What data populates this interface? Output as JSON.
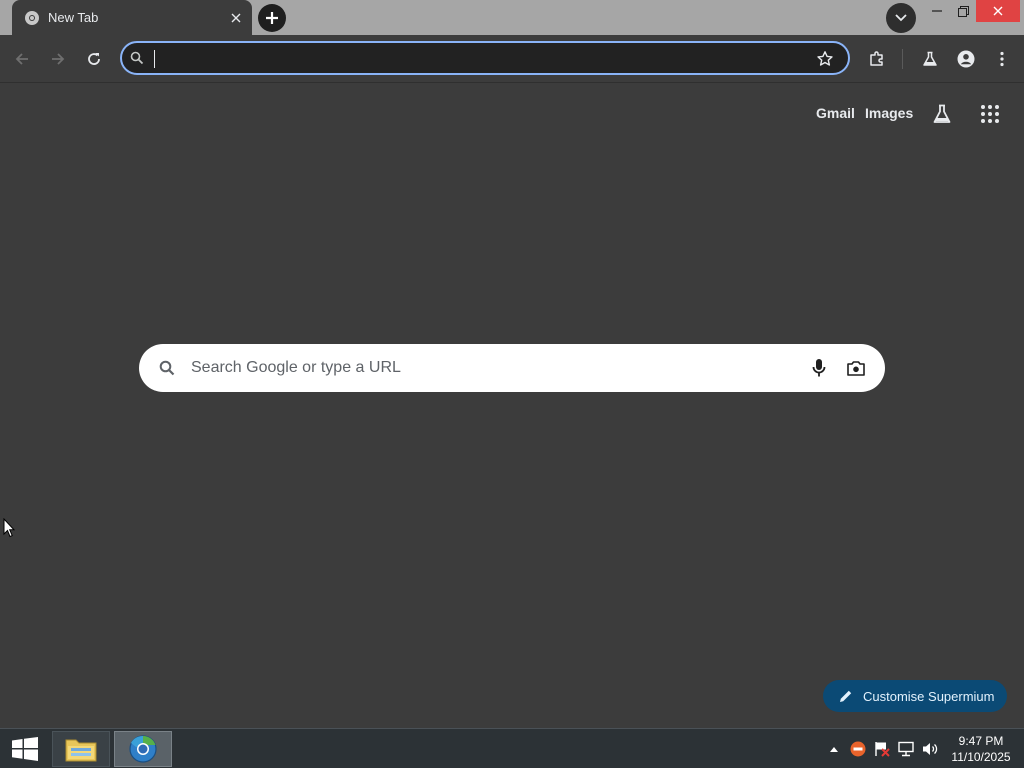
{
  "tab": {
    "title": "New Tab"
  },
  "omnibox": {
    "value": "",
    "placeholder": ""
  },
  "ntp": {
    "links": {
      "gmail": "Gmail",
      "images": "Images"
    },
    "search_placeholder": "Search Google or type a URL",
    "customise_label": "Customise Supermium"
  },
  "taskbar": {
    "time": "9:47 PM",
    "date": "11/10/2025"
  },
  "colors": {
    "accent": "#8ab4f8",
    "page_bg": "#3c3c3c",
    "tabstrip_bg": "#a6a6a6",
    "close_red": "#e04343",
    "customise_bg": "#0b4a75"
  },
  "icons": {
    "tab_favicon": "chrome-icon",
    "new_tab": "plus-icon",
    "tab_search": "chevron-down-icon",
    "back": "arrow-left-icon",
    "forward": "arrow-right-icon",
    "reload": "reload-icon",
    "bookmark": "star-icon",
    "extensions": "puzzle-icon",
    "labs": "flask-icon",
    "profile": "person-icon",
    "menu": "kebab-menu-icon",
    "apps": "grid-icon",
    "voice": "mic-icon",
    "image_search": "camera-icon",
    "customise": "pencil-icon"
  }
}
